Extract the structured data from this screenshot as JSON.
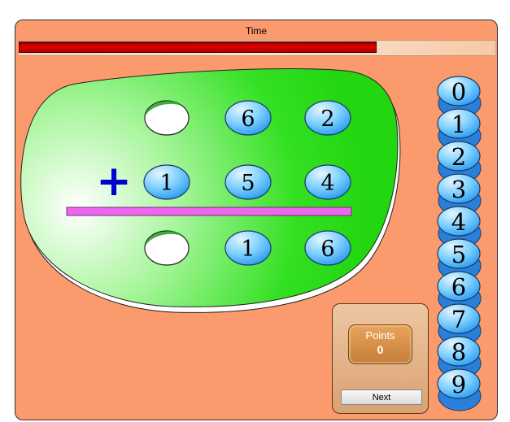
{
  "timer": {
    "label": "Time",
    "remaining_fraction": 0.75
  },
  "board": {
    "operator": "+",
    "rows": [
      {
        "name": "addend-top",
        "digits": [
          "",
          "6",
          "2"
        ]
      },
      {
        "name": "addend-bottom",
        "digits": [
          "1",
          "5",
          "4"
        ]
      },
      {
        "name": "sum",
        "digits": [
          "",
          "1",
          "6"
        ]
      }
    ]
  },
  "score": {
    "label": "Points",
    "value": "0"
  },
  "next_label": "Next",
  "digit_tiles": [
    "0",
    "1",
    "2",
    "3",
    "4",
    "5",
    "6",
    "7",
    "8",
    "9"
  ],
  "colors": {
    "board": "#33dd22",
    "tile": "#33aaff",
    "rule": "#ee66ee",
    "operator": "#0000cc",
    "timer_bar": "#cc0000"
  }
}
